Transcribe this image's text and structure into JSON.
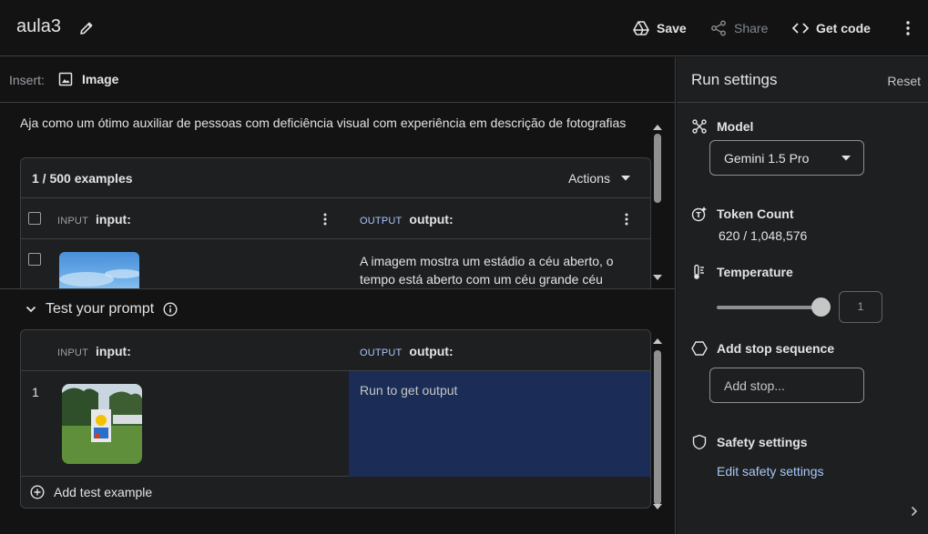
{
  "header": {
    "title": "aula3",
    "save_label": "Save",
    "share_label": "Share",
    "code_label": "Get code"
  },
  "insert": {
    "label": "Insert:",
    "image_label": "Image"
  },
  "system_instruction": "Aja como um ótimo auxiliar de pessoas com deficiência visual com experiência em descrição de fotografias",
  "examples": {
    "count": "1 / 500 examples",
    "actions_label": "Actions",
    "input_tag": "INPUT",
    "input_label": "input:",
    "output_tag": "OUTPUT",
    "output_label": "output:",
    "rows": [
      {
        "output": "A imagem mostra um estádio a céu aberto, o tempo está aberto com um céu grande céu"
      }
    ]
  },
  "test": {
    "heading": "Test your prompt",
    "input_tag": "INPUT",
    "input_label": "input:",
    "output_tag": "OUTPUT",
    "output_label": "output:",
    "rows": [
      {
        "number": "1",
        "output_placeholder": "Run to get output"
      }
    ],
    "add_label": "Add test example"
  },
  "run_settings": {
    "title": "Run settings",
    "reset_label": "Reset",
    "model_label": "Model",
    "model_value": "Gemini 1.5 Pro",
    "token_label": "Token Count",
    "token_value": "620 / 1,048,576",
    "temperature_label": "Temperature",
    "temperature_value": "1",
    "temperature_fraction": 0.9,
    "stop_label": "Add stop sequence",
    "stop_placeholder": "Add stop...",
    "safety_label": "Safety settings",
    "safety_link": "Edit safety settings"
  },
  "colors": {
    "background": "#131314",
    "panel": "#1e1f20",
    "accent_link": "#a8c7fa",
    "output_cell": "#1b2d57"
  }
}
